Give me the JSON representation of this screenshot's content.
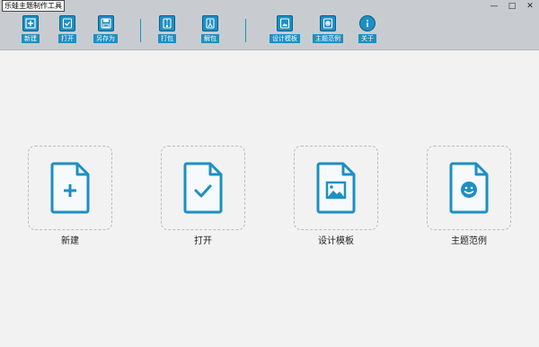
{
  "window": {
    "title": "乐蛙主题制作工具",
    "controls": {
      "minimize": "—",
      "maximize": "□",
      "close": "✕"
    }
  },
  "toolbar": {
    "new": "新建",
    "open": "打开",
    "save_as": "另存为",
    "pack": "打包",
    "unpack": "解包",
    "design_template": "设计模板",
    "theme_example": "主题范例",
    "about": "关于"
  },
  "cards": {
    "new": "新建",
    "open": "打开",
    "design_template": "设计模板",
    "theme_example": "主题范例"
  },
  "colors": {
    "accent": "#1d8fc3",
    "toolbar_bg": "#c8ccd0",
    "content_bg": "#f2f2f2"
  }
}
